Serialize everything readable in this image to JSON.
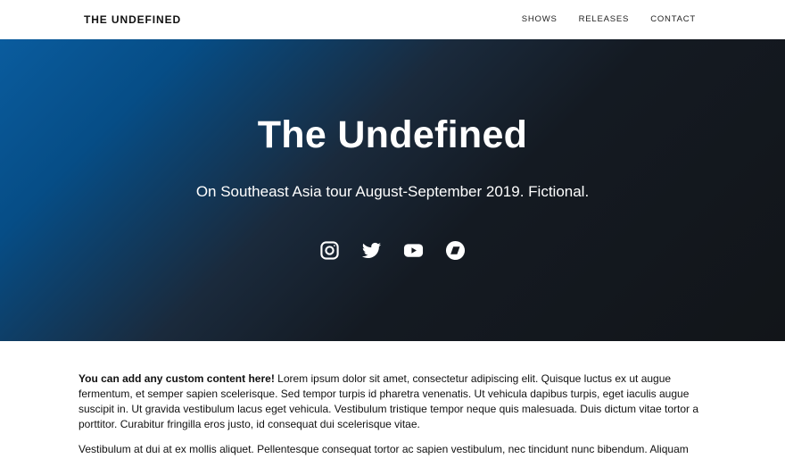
{
  "nav": {
    "brand": "THE UNDEFINED",
    "links": [
      "SHOWS",
      "RELEASES",
      "CONTACT"
    ]
  },
  "hero": {
    "title": "The Undefined",
    "subtitle": "On Southeast Asia tour August-September 2019. Fictional.",
    "social_icons": [
      "instagram-icon",
      "twitter-icon",
      "youtube-icon",
      "bandcamp-icon"
    ]
  },
  "content": {
    "p1_lead": "You can add any custom content here!",
    "p1_body": " Lorem ipsum dolor sit amet, consectetur adipiscing elit. Quisque luctus ex ut augue fermentum, et semper sapien scelerisque. Sed tempor turpis id pharetra venenatis. Ut vehicula dapibus turpis, eget iaculis augue suscipit in. Ut gravida vestibulum lacus eget vehicula. Vestibulum tristique tempor neque quis malesuada. Duis dictum vitae tortor a porttitor. Curabitur fringilla eros justo, id consequat dui scelerisque vitae.",
    "p2": "Vestibulum at dui at ex mollis aliquet. Pellentesque consequat tortor ac sapien vestibulum, nec tincidunt nunc bibendum. Aliquam"
  },
  "colors": {
    "hero_gradient_start": "#0a5c9e",
    "hero_gradient_end": "#121519",
    "text": "#111111",
    "background": "#ffffff"
  }
}
